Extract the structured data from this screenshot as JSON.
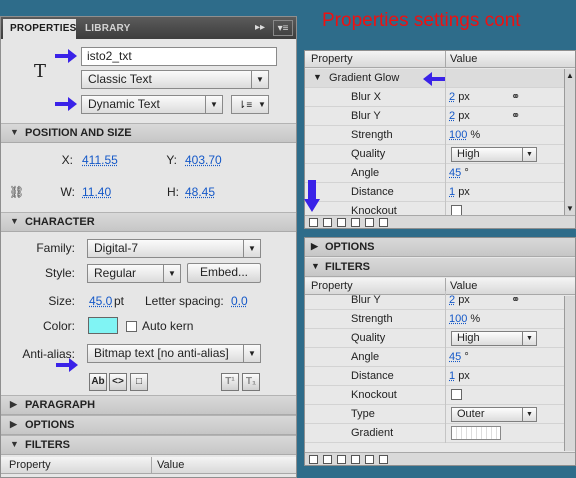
{
  "left_panel": {
    "tabs": [
      {
        "label": "PROPERTIES",
        "active": true
      },
      {
        "label": "LIBRARY",
        "active": false
      }
    ],
    "tab_controls": {
      "collapse": "▸▸",
      "menu": "▾≡"
    },
    "tool_icon": "text-tool-T",
    "instance_name": "isto2_txt",
    "text_engine": "Classic Text",
    "text_type": "Dynamic Text",
    "orientation_icon": "text-orientation-icon",
    "position": {
      "title": "POSITION AND SIZE",
      "x_label": "X:",
      "x_value": "411.55",
      "y_label": "Y:",
      "y_value": "403.70",
      "w_label": "W:",
      "w_value": "11.40",
      "h_label": "H:",
      "h_value": "48.45"
    },
    "character": {
      "title": "CHARACTER",
      "family_label": "Family:",
      "family_value": "Digital-7",
      "style_label": "Style:",
      "style_value": "Regular",
      "embed_label": "Embed...",
      "size_label": "Size:",
      "size_value": "45.0",
      "size_unit": "pt",
      "letter_spacing_label": "Letter spacing:",
      "letter_spacing_value": "0.0",
      "color_label": "Color:",
      "color_value": "#80f4f4",
      "auto_kern_label": "Auto kern",
      "anti_alias_label": "Anti-alias:",
      "anti_alias_value": "Bitmap text [no anti-alias]"
    },
    "format_buttons": [
      "Ab",
      "<>",
      "□"
    ],
    "superscript_labels": [
      "T¹",
      "T₁"
    ],
    "sections": [
      "PARAGRAPH",
      "OPTIONS",
      "FILTERS"
    ],
    "filters_header": {
      "property": "Property",
      "value": "Value"
    }
  },
  "title": "Properties settings cont",
  "top_filter_panel": {
    "header": {
      "property": "Property",
      "value": "Value"
    },
    "group": "Gradient Glow",
    "rows": [
      {
        "key": "Blur X",
        "value": "2",
        "unit": "px",
        "link": true
      },
      {
        "key": "Blur Y",
        "value": "2",
        "unit": "px",
        "link": true
      },
      {
        "key": "Strength",
        "value": "100",
        "unit": "%"
      },
      {
        "key": "Quality",
        "select": "High"
      },
      {
        "key": "Angle",
        "value": "45",
        "unit": "°"
      },
      {
        "key": "Distance",
        "value": "1",
        "unit": "px"
      },
      {
        "key": "Knockout",
        "checkbox": true
      }
    ]
  },
  "bottom_panel": {
    "sections": {
      "options": "OPTIONS",
      "filters": "FILTERS"
    },
    "header": {
      "property": "Property",
      "value": "Value"
    },
    "rows": [
      {
        "key": "Blur Y",
        "value": "2",
        "unit": "px",
        "link": true
      },
      {
        "key": "Strength",
        "value": "100",
        "unit": "%"
      },
      {
        "key": "Quality",
        "select": "High"
      },
      {
        "key": "Angle",
        "value": "45",
        "unit": "°"
      },
      {
        "key": "Distance",
        "value": "1",
        "unit": "px"
      },
      {
        "key": "Knockout",
        "checkbox": true
      },
      {
        "key": "Type",
        "select": "Outer"
      },
      {
        "key": "Gradient",
        "gradient": true
      }
    ]
  },
  "colors": {
    "annotation_arrow": "#3a22e8",
    "title": "#ee1111",
    "background": "#2e6c8a"
  }
}
